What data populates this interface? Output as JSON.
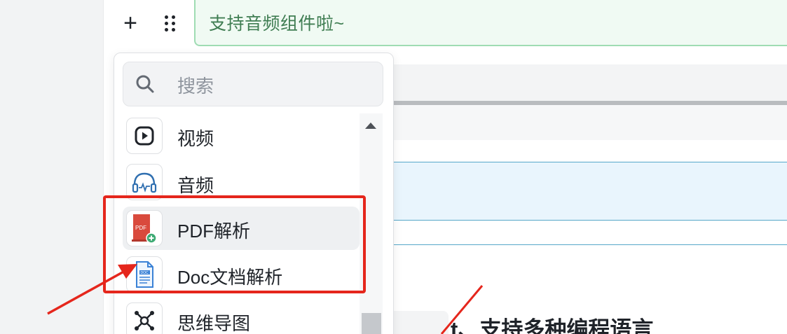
{
  "editor": {
    "text_block": "支持音频组件啦~",
    "heading_partial": "t、支持多种编程语言"
  },
  "toolbar": {
    "plus_icon": "plus-icon",
    "drag_icon": "drag-handle-icon"
  },
  "menu": {
    "search": {
      "placeholder": "搜索",
      "icon": "search-icon"
    },
    "items": [
      {
        "label": "视频",
        "icon": "video-play-icon"
      },
      {
        "label": "音频",
        "icon": "headphones-icon"
      },
      {
        "label": "PDF解析",
        "icon": "pdf-icon",
        "badge": "PDF"
      },
      {
        "label": "Doc文档解析",
        "icon": "doc-icon",
        "badge": "DOC"
      },
      {
        "label": "思维导图",
        "icon": "mindmap-icon"
      }
    ]
  },
  "colors": {
    "accent_green": "#9fdcb3",
    "annotation_red": "#e5261c",
    "pdf_red": "#d94a3d",
    "doc_blue": "#3b82d6"
  }
}
